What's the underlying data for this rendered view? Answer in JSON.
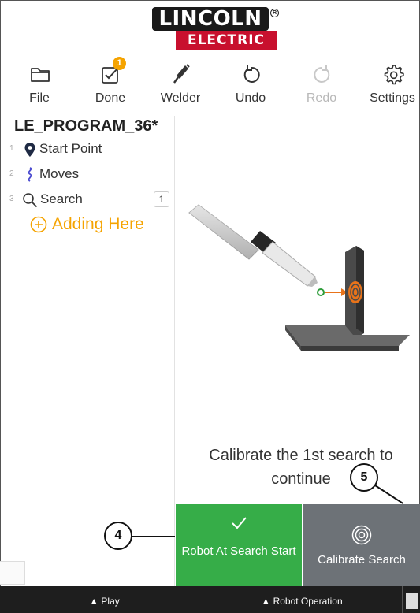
{
  "logo": {
    "top": "LINCOLN",
    "bottom": "ELECTRIC",
    "reg": "R"
  },
  "toolbar": {
    "items": [
      {
        "label": "File",
        "icon": "folder-icon"
      },
      {
        "label": "Done",
        "icon": "checkbox-icon",
        "badge": "1"
      },
      {
        "label": "Welder",
        "icon": "welder-icon"
      },
      {
        "label": "Undo",
        "icon": "undo-icon"
      },
      {
        "label": "Redo",
        "icon": "redo-icon",
        "disabled": true
      },
      {
        "label": "Settings",
        "icon": "gear-icon"
      }
    ]
  },
  "program": {
    "title": "LE_PROGRAM_36*",
    "steps": [
      {
        "num": "1",
        "label": "Start Point",
        "icon": "location-pin-icon"
      },
      {
        "num": "2",
        "label": "Moves",
        "icon": "squiggle-path-icon"
      },
      {
        "num": "3",
        "label": "Search",
        "icon": "search-icon",
        "count": "1"
      }
    ],
    "adding_label": "Adding Here"
  },
  "main": {
    "instruction": "Calibrate the 1st search to continue"
  },
  "actions": {
    "robot_at_search_start": "Robot At Search Start",
    "calibrate_search": "Calibrate Search"
  },
  "statusbar": {
    "play": "▲ Play",
    "robot_operation": "▲ Robot Operation"
  },
  "callouts": {
    "a": "4",
    "b": "5"
  },
  "colors": {
    "accent_orange": "#f5a300",
    "green": "#36ad48",
    "grey_button": "#6d7277",
    "brand_red": "#c8102e"
  }
}
